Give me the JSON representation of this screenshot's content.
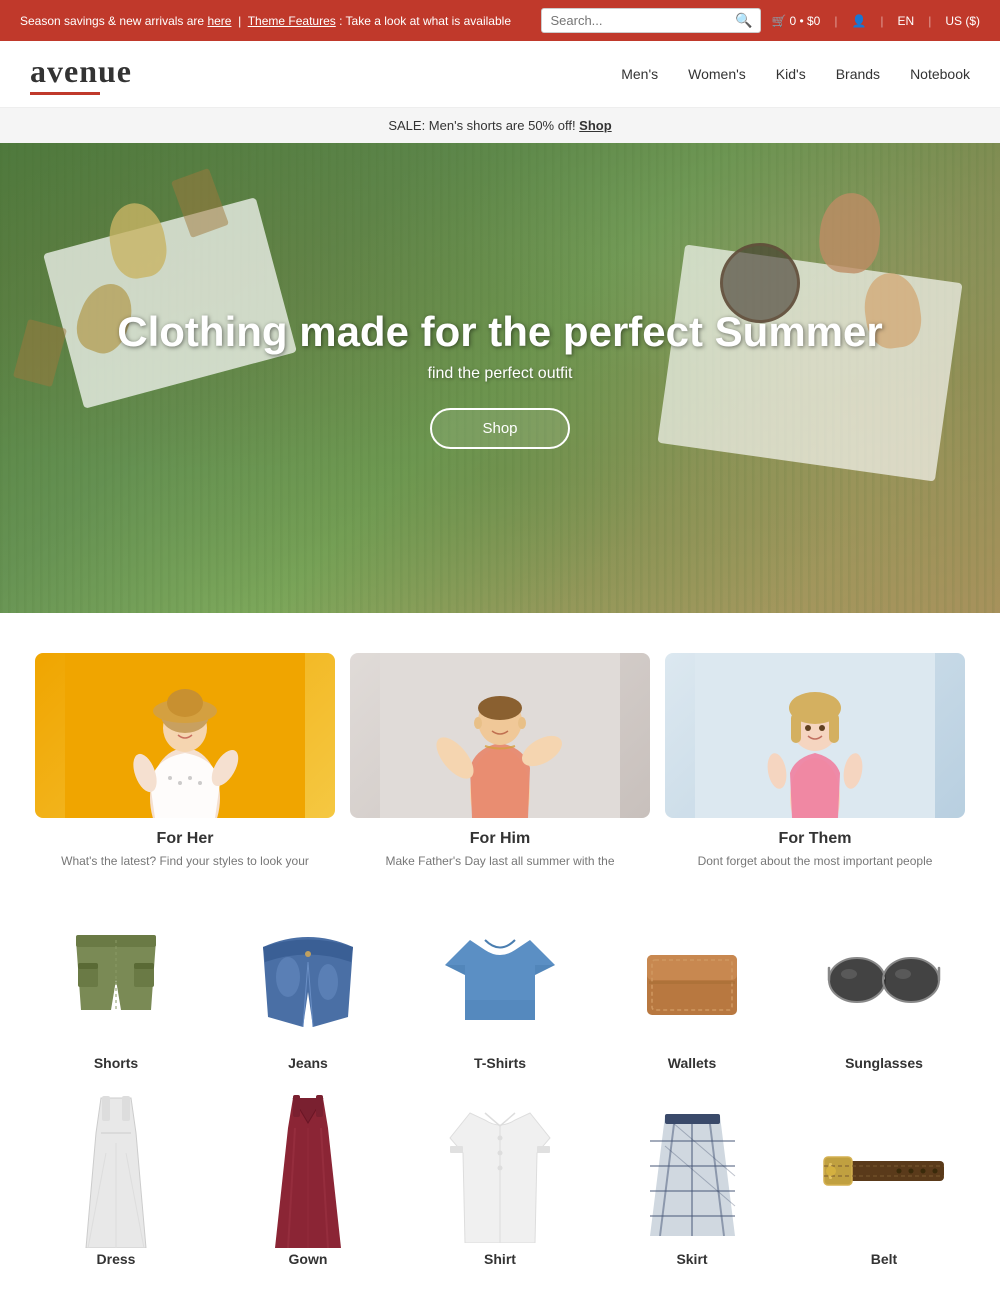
{
  "announcement": {
    "text_before": "Season savings & new arrivals are ",
    "here_link": "here",
    "separator": "|",
    "theme_link": "Theme Features",
    "text_after": ": Take a look at what is available"
  },
  "search": {
    "placeholder": "Search...",
    "label": "Search ."
  },
  "cart": {
    "label": "0 • $0"
  },
  "lang": "EN",
  "region": "US ($)",
  "logo": {
    "text": "avenue",
    "tagline": ""
  },
  "nav": {
    "items": [
      "Men's",
      "Women's",
      "Kid's",
      "Brands",
      "Notebook"
    ]
  },
  "sale_banner": {
    "text": "SALE: Men's shorts are 50% off! ",
    "link": "Shop"
  },
  "hero": {
    "title": "Clothing made for the perfect Summer",
    "subtitle": "find the perfect outfit",
    "cta": "Shop"
  },
  "categories": [
    {
      "id": "for-her",
      "title": "For Her",
      "description": "What's the latest? Find your styles to look your"
    },
    {
      "id": "for-him",
      "title": "For Him",
      "description": "Make Father's Day last all summer with the"
    },
    {
      "id": "for-them",
      "title": "For Them",
      "description": "Dont forget about the most important people"
    }
  ],
  "products_row1": [
    {
      "name": "Shorts",
      "color": "#6b7a4a"
    },
    {
      "name": "Jeans",
      "color": "#4a6fa5"
    },
    {
      "name": "T-Shirts",
      "color": "#5b8fc4"
    },
    {
      "name": "Wallets",
      "color": "#c4904a"
    },
    {
      "name": "Sunglasses",
      "color": "#333"
    }
  ],
  "products_row2": [
    {
      "name": "Dress",
      "color": "#ddd"
    },
    {
      "name": "Gown",
      "color": "#8b2a3a"
    },
    {
      "name": "Shirt",
      "color": "#fff"
    },
    {
      "name": "Skirt",
      "color": "#4a5a7a"
    },
    {
      "name": "Belt",
      "color": "#5a3a1a"
    }
  ]
}
